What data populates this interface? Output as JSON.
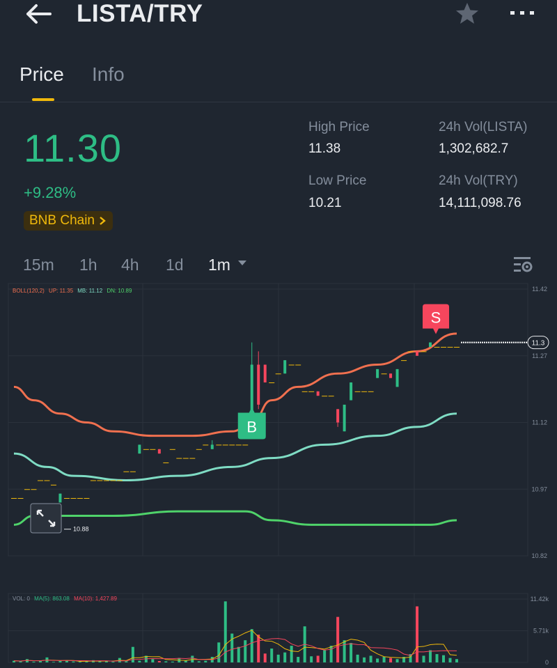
{
  "header": {
    "title": "LISTA/TRY"
  },
  "tabs": [
    {
      "label": "Price",
      "active": true
    },
    {
      "label": "Info",
      "active": false
    }
  ],
  "ticker": {
    "last_price": "11.30",
    "change_pct": "+9.28%",
    "chain_badge": "BNB Chain",
    "high_label": "High Price",
    "high_value": "11.38",
    "low_label": "Low Price",
    "low_value": "10.21",
    "vol_base_label": "24h Vol(LISTA)",
    "vol_base_value": "1,302,682.7",
    "vol_quote_label": "24h Vol(TRY)",
    "vol_quote_value": "14,111,098.76"
  },
  "intervals": [
    "15m",
    "1h",
    "4h",
    "1d",
    "1m"
  ],
  "active_interval": "1m",
  "colors": {
    "up": "#2ebd85",
    "down": "#f6465d",
    "accent": "#f0b90b",
    "boll_mid": "#f0704f",
    "boll_up": "#7fdcc4",
    "boll_dn": "#4fd36a"
  },
  "chart_data": {
    "type": "candlestick",
    "indicator_label": "BOLL(120,2)",
    "up_label": "UP: 11.35",
    "mb_label": "MB: 11.12",
    "dn_label": "DN: 10.89",
    "y_ticks": [
      "11.42",
      "11.27",
      "11.12",
      "10.97",
      "10.82"
    ],
    "ylim": [
      10.82,
      11.42
    ],
    "current_price_label": "11.3",
    "high_marker": "11.35",
    "low_marker": "10.88",
    "buy_marker": "B",
    "sell_marker": "S",
    "candles": [
      [
        1,
        10.95,
        10.95,
        10.95,
        10.95
      ],
      [
        2,
        10.95,
        10.95,
        10.95,
        10.95
      ],
      [
        3,
        10.97,
        10.97,
        10.97,
        10.97
      ],
      [
        4,
        10.97,
        10.97,
        10.97,
        10.97
      ],
      [
        5,
        10.99,
        10.99,
        10.99,
        10.99
      ],
      [
        6,
        10.99,
        10.99,
        10.99,
        10.99
      ],
      [
        7,
        10.98,
        10.98,
        10.98,
        10.98
      ],
      [
        8,
        10.94,
        10.96,
        10.94,
        10.96
      ],
      [
        9,
        10.95,
        10.95,
        10.95,
        10.95
      ],
      [
        10,
        10.95,
        10.95,
        10.95,
        10.95
      ],
      [
        11,
        10.95,
        10.95,
        10.95,
        10.95
      ],
      [
        12,
        10.95,
        10.95,
        10.95,
        10.95
      ],
      [
        13,
        10.99,
        10.99,
        10.99,
        10.99
      ],
      [
        14,
        10.99,
        10.99,
        10.99,
        10.99
      ],
      [
        15,
        10.99,
        10.99,
        10.99,
        10.99
      ],
      [
        16,
        10.99,
        10.99,
        10.99,
        10.99
      ],
      [
        17,
        10.99,
        10.99,
        10.99,
        10.99
      ],
      [
        18,
        11.01,
        11.01,
        11.01,
        11.01
      ],
      [
        19,
        11.01,
        11.01,
        11.01,
        11.01
      ],
      [
        20,
        11.05,
        11.07,
        11.05,
        11.07
      ],
      [
        21,
        11.06,
        11.06,
        11.06,
        11.06
      ],
      [
        22,
        11.06,
        11.06,
        11.06,
        11.06
      ],
      [
        23,
        11.06,
        11.06,
        11.05,
        11.05
      ],
      [
        24,
        11.03,
        11.03,
        11.03,
        11.03
      ],
      [
        25,
        11.06,
        11.06,
        11.06,
        11.06
      ],
      [
        26,
        11.04,
        11.04,
        11.04,
        11.04
      ],
      [
        27,
        11.04,
        11.04,
        11.04,
        11.04
      ],
      [
        28,
        11.04,
        11.04,
        11.04,
        11.04
      ],
      [
        29,
        11.06,
        11.06,
        11.06,
        11.06
      ],
      [
        30,
        11.07,
        11.07,
        11.07,
        11.07
      ],
      [
        31,
        11.06,
        11.08,
        11.06,
        11.07
      ],
      [
        32,
        11.07,
        11.07,
        11.07,
        11.07
      ],
      [
        33,
        11.07,
        11.07,
        11.07,
        11.07
      ],
      [
        34,
        11.07,
        11.07,
        11.07,
        11.07
      ],
      [
        35,
        11.07,
        11.07,
        11.07,
        11.07
      ],
      [
        36,
        11.07,
        11.07,
        11.07,
        11.07
      ],
      [
        37,
        11.14,
        11.3,
        11.14,
        11.25
      ],
      [
        38,
        11.25,
        11.28,
        11.15,
        11.16
      ],
      [
        39,
        11.25,
        11.25,
        11.21,
        11.21
      ],
      [
        40,
        11.21,
        11.21,
        11.21,
        11.21
      ],
      [
        41,
        11.23,
        11.23,
        11.23,
        11.23
      ],
      [
        42,
        11.23,
        11.26,
        11.23,
        11.26
      ],
      [
        43,
        11.25,
        11.25,
        11.25,
        11.25
      ],
      [
        44,
        11.25,
        11.25,
        11.25,
        11.25
      ],
      [
        45,
        11.19,
        11.19,
        11.19,
        11.19
      ],
      [
        46,
        11.19,
        11.19,
        11.19,
        11.19
      ],
      [
        47,
        11.19,
        11.19,
        11.18,
        11.18
      ],
      [
        48,
        11.18,
        11.18,
        11.18,
        11.18
      ],
      [
        49,
        11.18,
        11.18,
        11.18,
        11.18
      ],
      [
        50,
        11.15,
        11.15,
        11.11,
        11.12
      ],
      [
        51,
        11.1,
        11.16,
        11.1,
        11.16
      ],
      [
        52,
        11.17,
        11.21,
        11.17,
        11.21
      ],
      [
        53,
        11.19,
        11.19,
        11.19,
        11.19
      ],
      [
        54,
        11.19,
        11.19,
        11.19,
        11.19
      ],
      [
        55,
        11.19,
        11.19,
        11.19,
        11.19
      ],
      [
        56,
        11.22,
        11.24,
        11.22,
        11.24
      ],
      [
        57,
        11.23,
        11.23,
        11.23,
        11.23
      ],
      [
        58,
        11.23,
        11.23,
        11.22,
        11.22
      ],
      [
        59,
        11.2,
        11.24,
        11.2,
        11.24
      ],
      [
        60,
        11.26,
        11.26,
        11.26,
        11.26
      ],
      [
        61,
        11.28,
        11.28,
        11.28,
        11.28
      ],
      [
        62,
        11.28,
        11.28,
        11.27,
        11.27
      ],
      [
        63,
        11.28,
        11.28,
        11.28,
        11.28
      ],
      [
        64,
        11.29,
        11.3,
        11.29,
        11.3
      ],
      [
        65,
        11.29,
        11.29,
        11.29,
        11.29
      ],
      [
        66,
        11.29,
        11.29,
        11.29,
        11.29
      ],
      [
        67,
        11.29,
        11.29,
        11.29,
        11.29
      ],
      [
        68,
        11.29,
        11.29,
        11.29,
        11.29
      ]
    ],
    "boll_mid": [
      [
        1,
        11.2
      ],
      [
        4,
        11.17
      ],
      [
        8,
        11.14
      ],
      [
        12,
        11.12
      ],
      [
        16,
        11.1
      ],
      [
        22,
        11.09
      ],
      [
        28,
        11.09
      ],
      [
        34,
        11.1
      ],
      [
        37,
        11.12
      ],
      [
        40,
        11.17
      ],
      [
        44,
        11.2
      ],
      [
        50,
        11.23
      ],
      [
        56,
        11.25
      ],
      [
        62,
        11.28
      ],
      [
        68,
        11.32
      ]
    ],
    "boll_up": [
      [
        1,
        11.05
      ],
      [
        6,
        11.02
      ],
      [
        10,
        11.0
      ],
      [
        18,
        10.99
      ],
      [
        26,
        11.0
      ],
      [
        34,
        11.02
      ],
      [
        40,
        11.04
      ],
      [
        48,
        11.07
      ],
      [
        56,
        11.09
      ],
      [
        62,
        11.11
      ],
      [
        68,
        11.14
      ]
    ],
    "boll_dn": [
      [
        1,
        10.89
      ],
      [
        4,
        10.91
      ],
      [
        8,
        10.91
      ],
      [
        16,
        10.91
      ],
      [
        26,
        10.92
      ],
      [
        34,
        10.92
      ],
      [
        36,
        10.92
      ],
      [
        40,
        10.9
      ],
      [
        46,
        10.89
      ],
      [
        52,
        10.89
      ],
      [
        58,
        10.89
      ],
      [
        64,
        10.89
      ],
      [
        68,
        10.9
      ]
    ],
    "volume": {
      "label": "VOL: 0",
      "ma5_label": "MA(5): 863.08",
      "ma10_label": "MA(10): 1,427.89",
      "y_ticks": [
        "11.42k",
        "5.71k",
        "0"
      ],
      "ylim": [
        0,
        11420
      ]
    }
  }
}
